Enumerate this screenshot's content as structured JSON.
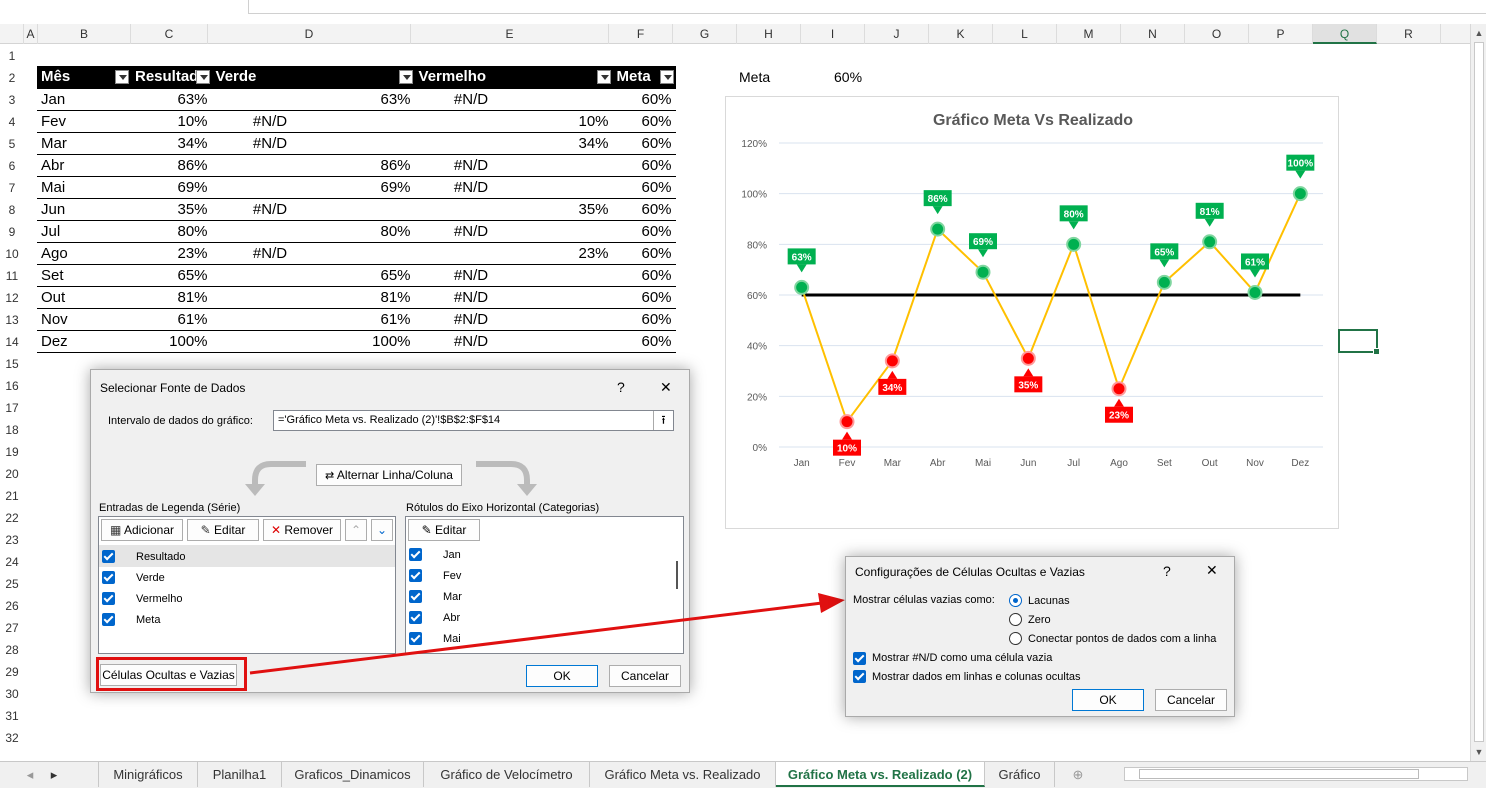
{
  "columns": [
    "A",
    "B",
    "C",
    "D",
    "E",
    "F",
    "G",
    "H",
    "I",
    "J",
    "K",
    "L",
    "M",
    "N",
    "O",
    "P",
    "Q",
    "R"
  ],
  "rows": [
    "1",
    "2",
    "3",
    "4",
    "5",
    "6",
    "7",
    "8",
    "9",
    "10",
    "11",
    "12",
    "13",
    "14",
    "15",
    "16",
    "17",
    "18",
    "19",
    "20",
    "21",
    "22",
    "23",
    "24",
    "25",
    "26",
    "27",
    "28",
    "29",
    "30",
    "31",
    "32"
  ],
  "table": {
    "headers": [
      "Mês",
      "Resultado",
      "Verde",
      "Vermelho",
      "Meta"
    ],
    "rows": [
      [
        "Jan",
        "63%",
        "",
        "63%",
        "#N/D",
        "",
        "60%"
      ],
      [
        "Fev",
        "10%",
        "#N/D",
        "",
        "",
        "10%",
        "60%"
      ],
      [
        "Mar",
        "34%",
        "#N/D",
        "",
        "",
        "34%",
        "60%"
      ],
      [
        "Abr",
        "86%",
        "",
        "86%",
        "#N/D",
        "",
        "60%"
      ],
      [
        "Mai",
        "69%",
        "",
        "69%",
        "#N/D",
        "",
        "60%"
      ],
      [
        "Jun",
        "35%",
        "#N/D",
        "",
        "",
        "35%",
        "60%"
      ],
      [
        "Jul",
        "80%",
        "",
        "80%",
        "#N/D",
        "",
        "60%"
      ],
      [
        "Ago",
        "23%",
        "#N/D",
        "",
        "",
        "23%",
        "60%"
      ],
      [
        "Set",
        "65%",
        "",
        "65%",
        "#N/D",
        "",
        "60%"
      ],
      [
        "Out",
        "81%",
        "",
        "81%",
        "#N/D",
        "",
        "60%"
      ],
      [
        "Nov",
        "61%",
        "",
        "61%",
        "#N/D",
        "",
        "60%"
      ],
      [
        "Dez",
        "100%",
        "",
        "100%",
        "#N/D",
        "",
        "60%"
      ]
    ]
  },
  "meta": {
    "label": "Meta",
    "value": "60%"
  },
  "chart_data": {
    "type": "line",
    "title": "Gráfico Meta Vs Realizado",
    "categories": [
      "Jan",
      "Fev",
      "Mar",
      "Abr",
      "Mai",
      "Jun",
      "Jul",
      "Ago",
      "Set",
      "Out",
      "Nov",
      "Dez"
    ],
    "yticks": [
      "0%",
      "20%",
      "40%",
      "60%",
      "80%",
      "100%",
      "120%"
    ],
    "ylim": [
      0,
      120
    ],
    "series": [
      {
        "name": "Resultado",
        "values": [
          63,
          10,
          34,
          86,
          69,
          35,
          80,
          23,
          65,
          81,
          61,
          100
        ],
        "color": "#ffc000"
      },
      {
        "name": "Meta",
        "values": [
          60,
          60,
          60,
          60,
          60,
          60,
          60,
          60,
          60,
          60,
          60,
          60
        ],
        "color": "#000000"
      }
    ],
    "labels": [
      "63%",
      "10%",
      "34%",
      "86%",
      "69%",
      "35%",
      "80%",
      "23%",
      "65%",
      "81%",
      "61%",
      "100%"
    ],
    "above_color": "#00b050",
    "below_color": "#ff0000",
    "grid": true
  },
  "dialog1": {
    "title": "Selecionar Fonte de Dados",
    "help": "?",
    "close": "✕",
    "range_label": "Intervalo de dados do gráfico:",
    "range_value": "='Gráfico Meta vs. Realizado (2)'!$B$2:$F$14",
    "switch_label": "Alternar Linha/Coluna",
    "legend_title": "Entradas de Legenda (Série)",
    "add": "Adicionar",
    "edit": "Editar",
    "remove": "Remover",
    "series": [
      "Resultado",
      "Verde",
      "Vermelho",
      "Meta"
    ],
    "axis_title": "Rótulos do Eixo Horizontal (Categorias)",
    "axis_edit": "Editar",
    "axis_items": [
      "Jan",
      "Fev",
      "Mar",
      "Abr",
      "Mai"
    ],
    "hidden_btn": "Células Ocultas e Vazias",
    "ok": "OK",
    "cancel": "Cancelar"
  },
  "dialog2": {
    "title": "Configurações de Células Ocultas e Vazias",
    "help": "?",
    "close": "✕",
    "show_empty": "Mostrar células vazias como:",
    "opt1": "Lacunas",
    "opt2": "Zero",
    "opt3": "Conectar pontos de dados com a linha",
    "chk1": "Mostrar #N/D como uma célula vazia",
    "chk2": "Mostrar dados em linhas e colunas ocultas",
    "ok": "OK",
    "cancel": "Cancelar"
  },
  "tabs": [
    "Minigráficos",
    "Planilha1",
    "Graficos_Dinamicos",
    "Gráfico de Velocímetro",
    "Gráfico Meta vs. Realizado",
    "Gráfico Meta vs. Realizado (2)",
    "Gráfico"
  ]
}
